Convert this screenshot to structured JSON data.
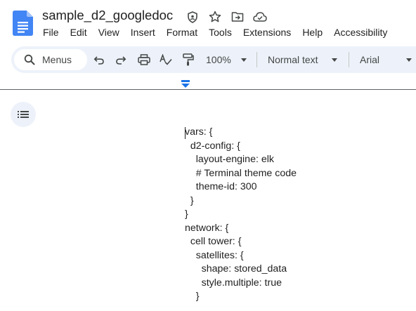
{
  "document": {
    "title": "sample_d2_googledoc"
  },
  "header_icons": [
    "shield-icon",
    "star-icon",
    "move-folder-icon",
    "cloud-saved-icon"
  ],
  "menubar": {
    "items": [
      "File",
      "Edit",
      "View",
      "Insert",
      "Format",
      "Tools",
      "Extensions",
      "Help",
      "Accessibility"
    ]
  },
  "toolbar": {
    "search_label": "Menus",
    "zoom": "100%",
    "paragraph_style": "Normal text",
    "font": "Arial"
  },
  "colors": {
    "logo_blue": "#4285f4",
    "toolbar_bg": "#edf2fa",
    "ruler_marker": "#1a73e8",
    "text": "#1f1f1f"
  },
  "body": {
    "lines": [
      "vars: {",
      "  d2-config: {",
      "    layout-engine: elk",
      "    # Terminal theme code",
      "    theme-id: 300",
      "  }",
      "}",
      "network: {",
      "  cell tower: {",
      "    satellites: {",
      "      shape: stored_data",
      "      style.multiple: true",
      "    }"
    ]
  }
}
